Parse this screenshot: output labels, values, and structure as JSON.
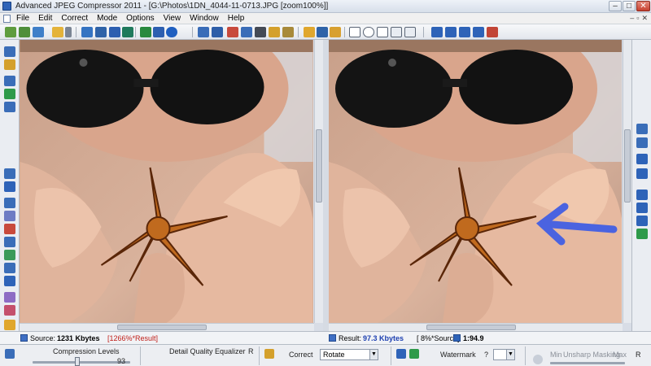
{
  "window": {
    "title": "Advanced JPEG Compressor 2011 - [G:\\Photos\\1DN_4044-11-0713.JPG  [zoom100%]]"
  },
  "menu": [
    "File",
    "Edit",
    "Correct",
    "Mode",
    "Options",
    "View",
    "Window",
    "Help"
  ],
  "status": {
    "source_label": "Source:",
    "source_size": "1231 Kbytes",
    "source_ratio": "[1266%*Result]",
    "result_label": "Result:",
    "result_size": "97.3 Kbytes",
    "result_ratio": "[ 8%*Source]",
    "compression_ratio": "1:94.9"
  },
  "panel": {
    "compression_label": "Compression Levels",
    "equalizer_label": "Detail Quality Equalizer",
    "equalizer_tag": "R",
    "correct_label": "Correct",
    "correct_value": "Rotate",
    "watermark_label": "Watermark",
    "watermark_tag": "?",
    "unsharp_label": "Unsharp Masking",
    "unsharp_min": "Min",
    "unsharp_max": "Max",
    "quality_value": "93"
  },
  "colors": {
    "accent": "#3f6fc4",
    "arrow": "#4a63e0",
    "red_text": "#c0201a",
    "blue_text": "#1c3fb0"
  }
}
